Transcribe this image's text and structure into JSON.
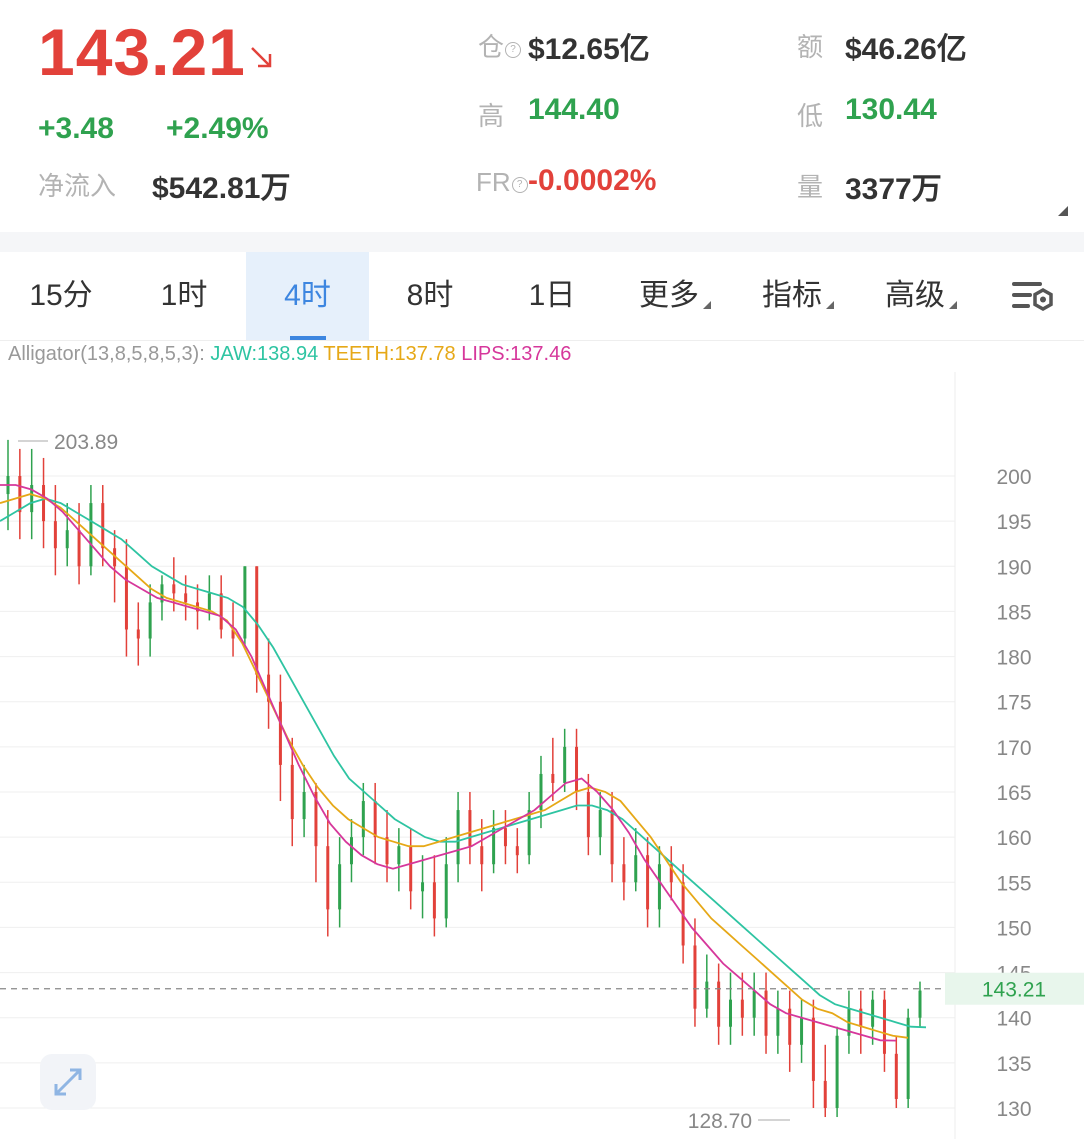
{
  "header": {
    "last_price": "143.21",
    "change_abs": "+3.48",
    "change_pct": "+2.49%",
    "net_inflow_label": "净流入",
    "net_inflow_value": "$542.81万",
    "open_interest_label": "仓",
    "open_interest_value": "$12.65亿",
    "high_label": "高",
    "high_value": "144.40",
    "funding_rate_label": "FR",
    "funding_rate_value": "-0.0002%",
    "amount_label": "额",
    "amount_value": "$46.26亿",
    "low_label": "低",
    "low_value": "130.44",
    "volume_label": "量",
    "volume_value": "3377万"
  },
  "tabs": [
    {
      "label": "15分",
      "active": false,
      "dropdown": false
    },
    {
      "label": "1时",
      "active": false,
      "dropdown": false
    },
    {
      "label": "4时",
      "active": true,
      "dropdown": false
    },
    {
      "label": "8时",
      "active": false,
      "dropdown": false
    },
    {
      "label": "1日",
      "active": false,
      "dropdown": false
    },
    {
      "label": "更多",
      "active": false,
      "dropdown": true
    },
    {
      "label": "指标",
      "active": false,
      "dropdown": true
    },
    {
      "label": "高级",
      "active": false,
      "dropdown": true
    }
  ],
  "indicator": {
    "name": "Alligator(13,8,5,8,5,3):",
    "jaw": "JAW:138.94",
    "teeth": "TEETH:137.78",
    "lips": "LIPS:137.46"
  },
  "colors": {
    "up": "#2fa24f",
    "down": "#e2413a",
    "active_tab": "#3d86e0",
    "jaw": "#2ec4a2",
    "teeth": "#e6a817",
    "lips": "#d6379b"
  },
  "chart_data": {
    "type": "candlestick",
    "y_ticks": [
      200,
      195,
      190,
      185,
      180,
      175,
      170,
      165,
      160,
      155,
      150,
      145,
      140,
      135,
      130
    ],
    "ylim": [
      128,
      208
    ],
    "current_price_label": "143.21",
    "current_price": 143.21,
    "max_marker": "203.89",
    "min_marker": "128.70",
    "grid": true,
    "candles": [
      [
        198,
        200,
        204,
        194
      ],
      [
        200,
        196,
        203,
        193
      ],
      [
        196,
        199,
        203,
        193
      ],
      [
        199,
        195,
        202,
        192
      ],
      [
        195,
        192,
        199,
        189
      ],
      [
        192,
        194,
        197,
        190
      ],
      [
        194,
        190,
        197,
        188
      ],
      [
        190,
        197,
        199,
        189
      ],
      [
        197,
        192,
        199,
        190
      ],
      [
        192,
        190,
        194,
        186
      ],
      [
        190,
        183,
        193,
        180
      ],
      [
        183,
        182,
        186,
        179
      ],
      [
        182,
        186,
        188,
        180
      ],
      [
        186,
        188,
        189,
        184
      ],
      [
        188,
        187,
        191,
        185
      ],
      [
        187,
        186,
        189,
        184
      ],
      [
        186,
        185,
        188,
        183
      ],
      [
        185,
        187,
        189,
        184
      ],
      [
        187,
        183,
        189,
        182
      ],
      [
        183,
        182,
        186,
        180
      ],
      [
        182,
        190,
        190,
        181
      ],
      [
        190,
        178,
        190,
        176
      ],
      [
        178,
        175,
        182,
        172
      ],
      [
        175,
        168,
        178,
        164
      ],
      [
        168,
        162,
        171,
        159
      ],
      [
        162,
        165,
        168,
        160
      ],
      [
        165,
        159,
        166,
        155
      ],
      [
        159,
        152,
        163,
        149
      ],
      [
        152,
        157,
        160,
        150
      ],
      [
        157,
        160,
        162,
        155
      ],
      [
        160,
        164,
        166,
        158
      ],
      [
        164,
        160,
        166,
        157
      ],
      [
        160,
        157,
        163,
        155
      ],
      [
        157,
        159,
        161,
        154
      ],
      [
        159,
        154,
        161,
        152
      ],
      [
        154,
        155,
        158,
        151
      ],
      [
        155,
        151,
        158,
        149
      ],
      [
        151,
        157,
        160,
        150
      ],
      [
        157,
        163,
        165,
        155
      ],
      [
        163,
        159,
        165,
        157
      ],
      [
        159,
        157,
        162,
        154
      ],
      [
        157,
        161,
        163,
        156
      ],
      [
        161,
        159,
        163,
        157
      ],
      [
        159,
        158,
        161,
        156
      ],
      [
        158,
        163,
        165,
        157
      ],
      [
        163,
        167,
        169,
        161
      ],
      [
        167,
        166,
        171,
        164
      ],
      [
        166,
        170,
        172,
        165
      ],
      [
        170,
        165,
        172,
        163
      ],
      [
        165,
        160,
        167,
        158
      ],
      [
        160,
        163,
        165,
        158
      ],
      [
        163,
        157,
        165,
        155
      ],
      [
        157,
        155,
        160,
        153
      ],
      [
        155,
        158,
        161,
        154
      ],
      [
        158,
        152,
        160,
        150
      ],
      [
        152,
        157,
        159,
        150
      ],
      [
        157,
        155,
        159,
        153
      ],
      [
        155,
        148,
        157,
        146
      ],
      [
        148,
        141,
        151,
        139
      ],
      [
        141,
        144,
        147,
        140
      ],
      [
        144,
        139,
        146,
        137
      ],
      [
        139,
        142,
        145,
        137
      ],
      [
        142,
        140,
        145,
        138
      ],
      [
        140,
        143,
        145,
        138
      ],
      [
        143,
        138,
        145,
        136
      ],
      [
        138,
        141,
        143,
        136
      ],
      [
        141,
        137,
        143,
        134
      ],
      [
        137,
        140,
        142,
        135
      ],
      [
        140,
        133,
        142,
        130
      ],
      [
        133,
        130,
        137,
        129
      ],
      [
        130,
        138,
        139,
        129
      ],
      [
        138,
        141,
        143,
        136
      ],
      [
        141,
        139,
        143,
        136
      ],
      [
        139,
        142,
        143,
        137
      ],
      [
        142,
        136,
        143,
        134
      ],
      [
        136,
        131,
        138,
        130
      ],
      [
        131,
        140,
        141,
        130
      ],
      [
        140,
        143,
        144,
        139
      ]
    ],
    "series": [
      {
        "name": "JAW",
        "values": [
          195,
          196,
          197,
          197.5,
          197,
          196,
          195,
          194,
          193,
          191.5,
          190,
          189,
          188,
          187.5,
          187,
          186.5,
          185.5,
          183.5,
          181,
          178,
          175,
          172,
          169,
          166.5,
          165,
          163.5,
          162,
          161,
          160,
          159.5,
          159.5,
          160,
          160.5,
          161,
          161.5,
          162,
          162.5,
          163,
          163.5,
          163.5,
          163,
          162,
          160.5,
          159,
          157.5,
          156,
          154.5,
          153,
          151.5,
          150,
          148.5,
          147,
          145.5,
          144,
          142.5,
          141.5,
          141,
          140.5,
          140,
          139.5,
          139,
          138.94
        ]
      },
      {
        "name": "TEETH",
        "values": [
          197,
          197.5,
          198,
          197.5,
          196.5,
          195,
          193.5,
          192,
          190.5,
          189,
          187.5,
          186.5,
          186,
          185.5,
          185,
          184,
          181.5,
          178,
          174.5,
          171,
          168,
          165.5,
          163.5,
          162,
          161,
          160,
          159.5,
          159,
          159,
          159.5,
          160,
          160.5,
          161,
          161.5,
          162,
          162.5,
          163,
          164,
          165,
          165.5,
          165,
          164,
          162,
          160,
          157.5,
          155,
          153,
          151,
          149.5,
          148,
          146.5,
          145,
          143.5,
          142,
          141,
          140.5,
          139.5,
          139,
          138.5,
          138,
          137.78
        ]
      },
      {
        "name": "LIPS",
        "values": [
          199,
          199,
          198.5,
          197.5,
          196,
          194,
          192,
          190,
          188.5,
          187.5,
          186.5,
          186,
          185.5,
          185,
          184.5,
          183,
          180,
          176,
          172,
          168,
          164.5,
          161.5,
          159.5,
          158,
          157,
          156.5,
          157,
          157.5,
          158,
          158.5,
          159,
          160,
          161,
          162,
          163,
          164.5,
          166,
          166.5,
          165,
          163,
          160.5,
          157.5,
          155,
          152.5,
          150,
          148,
          146,
          144.5,
          143,
          141.5,
          140.5,
          140,
          139.5,
          139,
          138.5,
          138,
          137.5,
          137.46
        ]
      }
    ]
  }
}
